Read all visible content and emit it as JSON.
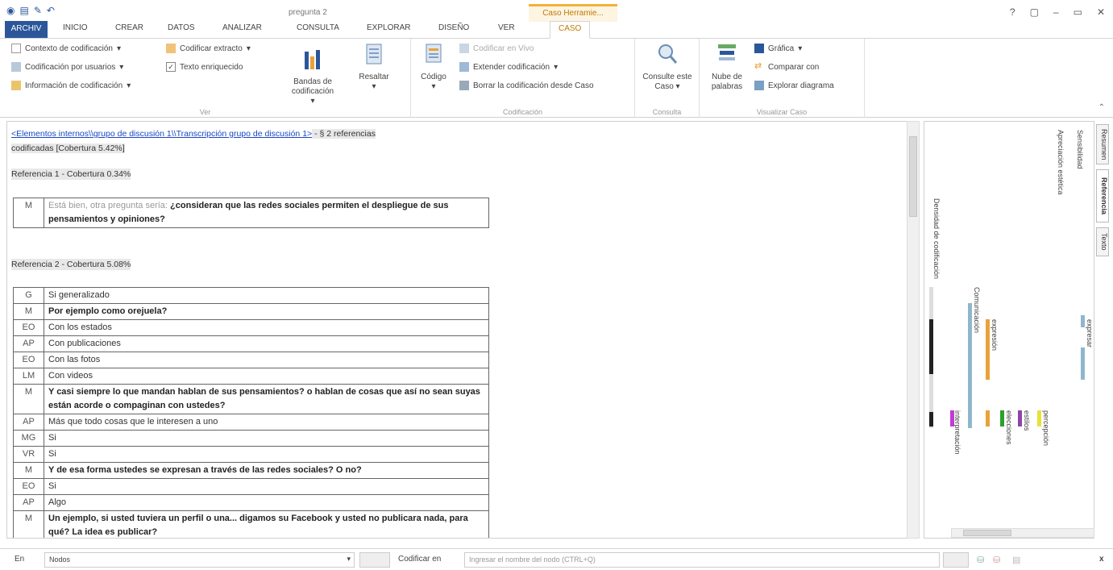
{
  "titlebar": {
    "doc_title": "pregunta 2",
    "context_tab_title": "Caso  Herramie...",
    "help": "?",
    "controls": [
      "▢",
      "–",
      "▭",
      "✕"
    ]
  },
  "tabs": {
    "file": "ARCHIV",
    "items": [
      "INICIO",
      "CREAR",
      "DATOS",
      "ANALIZAR",
      "CONSULTA",
      "EXPLORAR",
      "DISEÑO",
      "VER"
    ],
    "active": "CASO"
  },
  "ribbon": {
    "ver": {
      "items": [
        "Contexto de codificación",
        "Codificación por usuarios",
        "Información de codificación"
      ],
      "items2": [
        "Codificar extracto",
        "Texto enriquecido"
      ],
      "bandas": "Bandas de codificación",
      "resaltar": "Resaltar",
      "label": "Ver"
    },
    "codif": {
      "codigo": "Código",
      "items": [
        "Codificar en Vivo",
        "Extender codificación",
        "Borrar la codificación desde Caso"
      ],
      "label": "Codificación"
    },
    "consulta": {
      "btn": "Consulte este Caso",
      "label": "Consulta"
    },
    "visual": {
      "nube": "Nube de palabras",
      "items": [
        "Gráfica",
        "Comparar con",
        "Explorar diagrama"
      ],
      "label": "Visualizar Caso"
    }
  },
  "content": {
    "link": "<Elementos internos\\\\grupo de discusión 1\\\\Transcripción grupo de discusión 1>",
    "summary1": " - § 2 referencias",
    "summary2": "codificadas  [Cobertura 5.42%]",
    "ref1": "Referencia 1 - Cobertura 0.34%",
    "ref1_rows": [
      {
        "sp": "M",
        "pre": "Está bien, otra pregunta sería: ",
        "text": "¿consideran que las redes sociales permiten el despliegue de sus pensamientos y opiniones?",
        "bold": true
      }
    ],
    "ref2": "Referencia 2 - Cobertura 5.08%",
    "ref2_rows": [
      {
        "sp": "G",
        "text": "Si generalizado",
        "bold": false
      },
      {
        "sp": "M",
        "text": "Por ejemplo como orejuela?",
        "bold": true
      },
      {
        "sp": "EO",
        "text": "Con los estados",
        "bold": false
      },
      {
        "sp": "AP",
        "text": "Con publicaciones",
        "bold": false
      },
      {
        "sp": "EO",
        "text": "Con las fotos",
        "bold": false
      },
      {
        "sp": "LM",
        "text": "Con videos",
        "bold": false
      },
      {
        "sp": "M",
        "text": "Y casi siempre lo que mandan hablan de sus pensamientos? o hablan de cosas que así no sean suyas están acorde o compaginan con ustedes?",
        "bold": true
      },
      {
        "sp": "AP",
        "text": "Más que todo cosas que le interesen a uno",
        "bold": false
      },
      {
        "sp": "MG",
        "text": "Si",
        "bold": false
      },
      {
        "sp": "VR",
        "text": "Si",
        "bold": false
      },
      {
        "sp": "M",
        "text": "Y de esa forma ustedes se expresan a través de las redes sociales? O no?",
        "bold": true
      },
      {
        "sp": "EO",
        "text": "Si",
        "bold": false
      },
      {
        "sp": "AP",
        "text": "Algo",
        "bold": false
      },
      {
        "sp": "M",
        "text": "Un ejemplo, si usted tuviera un perfil o una... digamos su Facebook y usted no publicara nada, para qué? La idea es publicar?",
        "bold": true
      }
    ]
  },
  "stripes": {
    "labels": [
      "Sensibilidad",
      "Apreciación estética",
      "Densidad de codificación",
      "Comunicación",
      "expresión",
      "expresar",
      "interpretación",
      "elecciones",
      "estilos",
      "percepción"
    ],
    "colors": {
      "density": "#222222",
      "blue": "#8fb7cc",
      "orange": "#e8a23a",
      "magenta": "#c23bd6",
      "green": "#2ca02c",
      "purple": "#8e44ad",
      "yellow": "#e6e23a"
    }
  },
  "side_tabs": [
    "Resumen",
    "Referencia",
    "Texto"
  ],
  "statusbar": {
    "en": "En",
    "nodos": "Nodos",
    "codificar_en": "Codificar en",
    "placeholder": "Ingresar el nombre del nodo (CTRL+Q)",
    "close": "x"
  }
}
